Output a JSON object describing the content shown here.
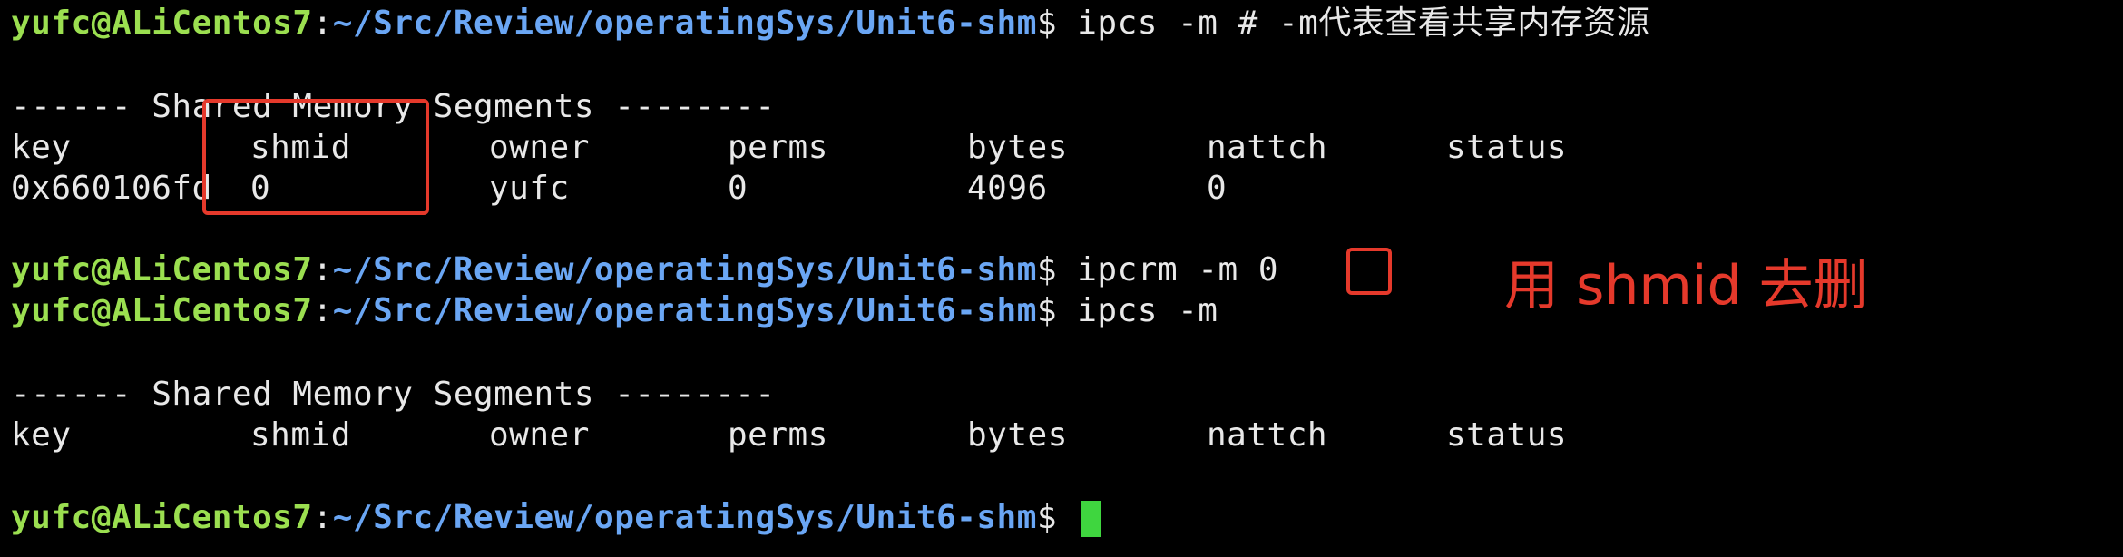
{
  "prompt": {
    "user_host": "yufc@ALiCentos7",
    "colon": ":",
    "path": "~/Src/Review/operatingSys/Unit6-shm",
    "dollar": "$"
  },
  "commands": {
    "cmd1": " ipcs -m # -m代表查看共享内存资源",
    "cmd2": " ipcrm -m ",
    "cmd2_arg": "0",
    "cmd3": " ipcs -m"
  },
  "table": {
    "section_header": "------ Shared Memory Segments --------",
    "columns": [
      "key",
      "shmid",
      "owner",
      "perms",
      "bytes",
      "nattch",
      "status"
    ],
    "rows": [
      [
        "0x660106fd",
        "0",
        "yufc",
        "0",
        "4096",
        "0",
        ""
      ]
    ]
  },
  "annotation": {
    "text": "用 shmid 去删"
  },
  "colors": {
    "user": "#9bdf50",
    "path": "#6aa6f4",
    "text": "#e8e8e8",
    "annotation": "#e5392b",
    "cursor": "#3fd63f",
    "background": "#000000"
  }
}
